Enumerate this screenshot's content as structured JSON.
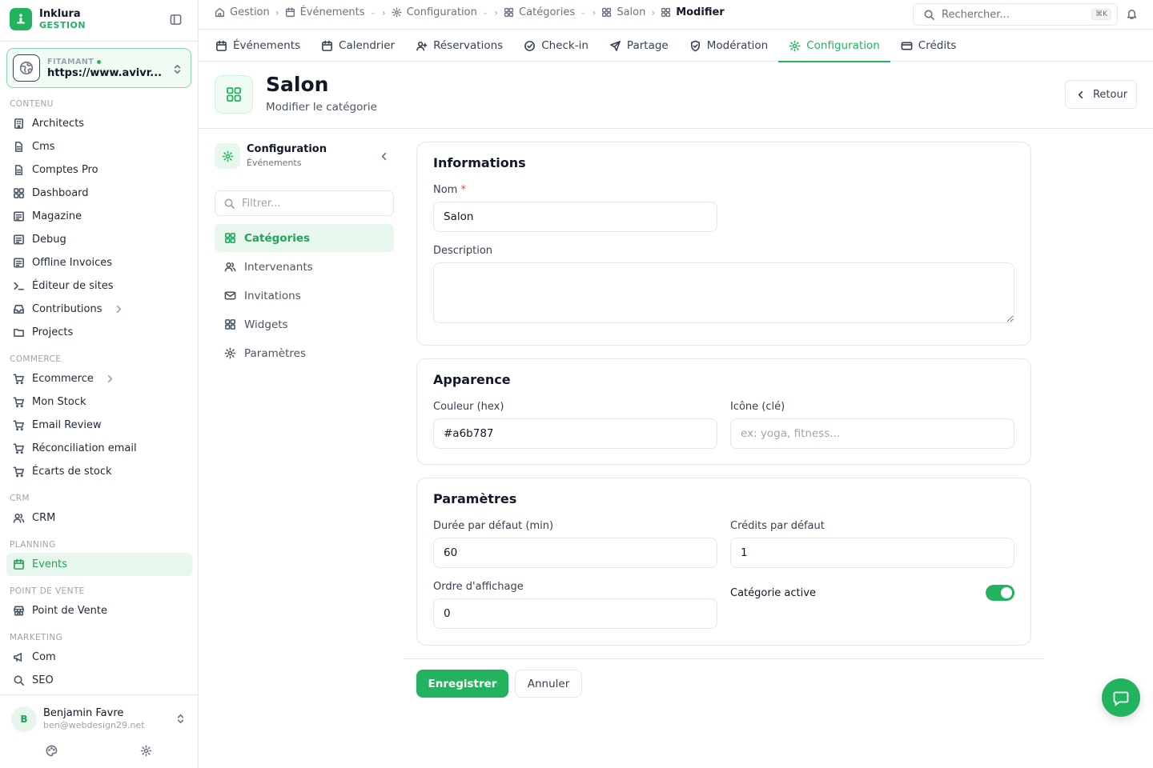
{
  "brand": {
    "name": "Inklura",
    "sub": "GESTION"
  },
  "site": {
    "label": "FITAMANT",
    "url": "https://www.avivr..."
  },
  "sidebar": {
    "groups": [
      {
        "title": "CONTENU",
        "items": [
          "Architects",
          "Cms",
          "Comptes Pro",
          "Dashboard",
          "Magazine",
          "Debug",
          "Offline Invoices",
          "Éditeur de sites",
          "Contributions",
          "Projects"
        ]
      },
      {
        "title": "COMMERCE",
        "items": [
          "Ecommerce",
          "Mon Stock",
          "Email Review",
          "Réconciliation email",
          "Écarts de stock"
        ]
      },
      {
        "title": "CRM",
        "items": [
          "CRM"
        ]
      },
      {
        "title": "PLANNING",
        "items": [
          "Events"
        ]
      },
      {
        "title": "POINT DE VENTE",
        "items": [
          "Point de Vente"
        ]
      },
      {
        "title": "MARKETING",
        "items": [
          "Com",
          "SEO"
        ]
      }
    ]
  },
  "user": {
    "initial": "B",
    "name": "Benjamin Favre",
    "email": "ben@webdesign29.net"
  },
  "breadcrumb": [
    "Gestion",
    "Événements",
    "Configuration",
    "Catégories",
    "Salon",
    "Modifier"
  ],
  "search": {
    "placeholder": "Rechercher...",
    "shortcut": "⌘K"
  },
  "tabs": [
    "Événements",
    "Calendrier",
    "Réservations",
    "Check-in",
    "Partage",
    "Modération",
    "Configuration",
    "Crédits"
  ],
  "header": {
    "title": "Salon",
    "subtitle": "Modifier le catégorie",
    "back": "Retour"
  },
  "config": {
    "title": "Configuration",
    "subtitle": "Événements",
    "filter_placeholder": "Filtrer...",
    "items": [
      "Catégories",
      "Intervenants",
      "Invitations",
      "Widgets",
      "Paramètres"
    ]
  },
  "form": {
    "info": {
      "title": "Informations",
      "name_label": "Nom",
      "required": "*",
      "name_value": "Salon",
      "desc_label": "Description",
      "desc_value": ""
    },
    "appearance": {
      "title": "Apparence",
      "color_label": "Couleur (hex)",
      "color_value": "#a6b787",
      "icon_label": "Icône (clé)",
      "icon_placeholder": "ex: yoga, fitness..."
    },
    "params": {
      "title": "Paramètres",
      "duration_label": "Durée par défaut (min)",
      "duration_value": "60",
      "credits_label": "Crédits par défaut",
      "credits_value": "1",
      "order_label": "Ordre d'affichage",
      "order_value": "0",
      "active_label": "Catégorie active",
      "active": true
    }
  },
  "actions": {
    "save": "Enregistrer",
    "cancel": "Annuler"
  },
  "colors": {
    "accent": "#22b35e"
  }
}
